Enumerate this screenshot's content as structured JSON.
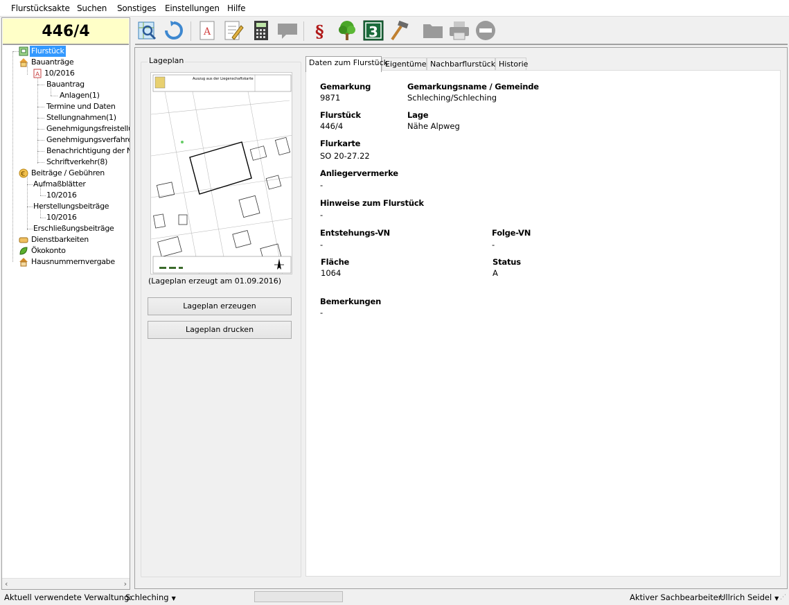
{
  "menu": [
    "Flurstücksakte",
    "Suchen",
    "Sonstiges",
    "Einstellungen",
    "Hilfe"
  ],
  "id_label": "446/4",
  "tree": {
    "flurstueck": "Flurstück",
    "bauantraege": "Bauanträge",
    "year_2016": "10/2016",
    "bauantrag": "Bauantrag",
    "anlagen": "Anlagen(1)",
    "termine": "Termine und Daten",
    "stellungnahmen": "Stellungnahmen(1)",
    "genehmigungsfreistellung": "Genehmigungsfreistellung",
    "genehmigungsverfahren": "Genehmigungsverfahren(",
    "benachrichtigung": "Benachrichtigung der Nac",
    "schriftverkehr": "Schriftverkehr(8)",
    "beitraege": "Beiträge / Gebühren",
    "aufmass": "Aufmaßblätter",
    "aufmass_year": "10/2016",
    "herstellung": "Herstellungsbeiträge",
    "herstellung_year": "10/2016",
    "erschliessung": "Erschließungsbeiträge",
    "dienstbarkeiten": "Dienstbarkeiten",
    "oekokonto": "Ökokonto",
    "hausnummern": "Hausnummernvergabe"
  },
  "lageplan": {
    "title": "Lageplan",
    "caption": "(Lageplan erzeugt am 01.09.2016)",
    "btn_create": "Lageplan erzeugen",
    "btn_print": "Lageplan drucken",
    "map_header": "Auszug aus der Liegenschaftskarte"
  },
  "tabs": [
    "Daten zum Flurstück",
    "Eigentümer",
    "Nachbarflurstücke",
    "Historie"
  ],
  "details": {
    "gemarkung_l": "Gemarkung",
    "gemarkung_v": "9871",
    "gname_l": "Gemarkungsname / Gemeinde",
    "gname_v": "Schleching/Schleching",
    "flurstueck_l": "Flurstück",
    "flurstueck_v": "446/4",
    "lage_l": "Lage",
    "lage_v": "Nähe Alpweg",
    "flurkarte_l": "Flurkarte",
    "flurkarte_v": "SO 20-27.22",
    "anlieger_l": "Anliegervermerke",
    "anlieger_v": "-",
    "hinweise_l": "Hinweise zum Flurstück",
    "hinweise_v": "-",
    "entstehung_l": "Entstehungs-VN",
    "entstehung_v": "-",
    "folge_l": "Folge-VN",
    "folge_v": "-",
    "flaeche_l": "Fläche",
    "flaeche_v": "1064",
    "status_l": "Status",
    "status_v": "A",
    "bemerkungen_l": "Bemerkungen",
    "bemerkungen_v": "-"
  },
  "statusbar": {
    "verwaltung_label": "Aktuell verwendete Verwaltung:",
    "verwaltung_value": "Schleching",
    "sachbearbeiter_label": "Aktiver Sachbearbeiter:",
    "sachbearbeiter_value": "Ullrich Seidel"
  },
  "icons": [
    "map-search-icon",
    "refresh-icon",
    "document-icon",
    "edit-document-icon",
    "calculator-icon",
    "comment-icon",
    "paragraph-icon",
    "tree-icon",
    "number-3-icon",
    "hammer-icon",
    "folder-icon",
    "printer-icon",
    "stop-icon"
  ]
}
